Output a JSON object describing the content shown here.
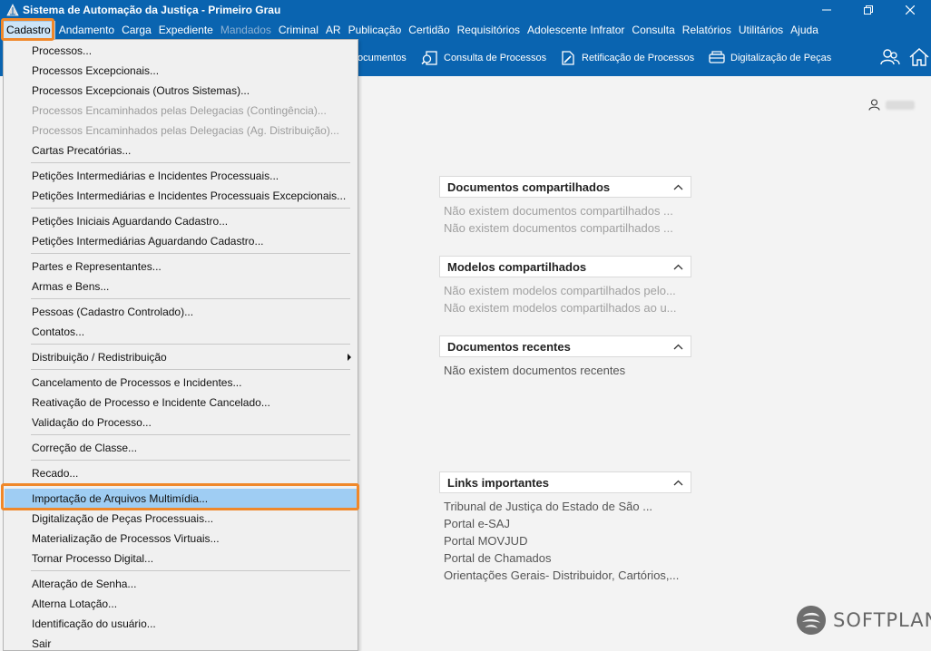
{
  "window": {
    "title": "Sistema de Automação da Justiça - Primeiro Grau"
  },
  "menubar": {
    "items": [
      {
        "label": "Cadastro",
        "state": "active"
      },
      {
        "label": "Andamento",
        "state": "normal"
      },
      {
        "label": "Carga",
        "state": "normal"
      },
      {
        "label": "Expediente",
        "state": "normal"
      },
      {
        "label": "Mandados",
        "state": "disabled"
      },
      {
        "label": "Criminal",
        "state": "normal"
      },
      {
        "label": "AR",
        "state": "normal"
      },
      {
        "label": "Publicação",
        "state": "normal"
      },
      {
        "label": "Certidão",
        "state": "normal"
      },
      {
        "label": "Requisitórios",
        "state": "normal"
      },
      {
        "label": "Adolescente Infrator",
        "state": "normal"
      },
      {
        "label": "Consulta",
        "state": "normal"
      },
      {
        "label": "Relatórios",
        "state": "normal"
      },
      {
        "label": "Utilitários",
        "state": "normal"
      },
      {
        "label": "Ajuda",
        "state": "normal"
      }
    ]
  },
  "toolbar": {
    "partial_label": "ocumentos",
    "consulta_label": "Consulta de Processos",
    "retificacao_label": "Retificação de Processos",
    "digitalizacao_label": "Digitalização de Peças"
  },
  "cadastro_menu": {
    "items": [
      {
        "label": "Processos...",
        "disabled": false
      },
      {
        "label": "Processos Excepcionais...",
        "disabled": false
      },
      {
        "label": "Processos Excepcionais (Outros Sistemas)...",
        "disabled": false
      },
      {
        "label": "Processos Encaminhados pelas Delegacias (Contingência)...",
        "disabled": true
      },
      {
        "label": "Processos Encaminhados pelas Delegacias (Ag. Distribuição)...",
        "disabled": true
      },
      {
        "label": "Cartas Precatórias...",
        "disabled": false
      },
      {
        "label": "Petições Intermediárias e Incidentes Processuais...",
        "disabled": false
      },
      {
        "label": "Petições Intermediárias e Incidentes Processuais Excepcionais...",
        "disabled": false
      },
      {
        "label": "Petições Iniciais Aguardando Cadastro...",
        "disabled": false
      },
      {
        "label": "Petições Intermediárias Aguardando Cadastro...",
        "disabled": false
      },
      {
        "label": "Partes e Representantes...",
        "disabled": false
      },
      {
        "label": "Armas e Bens...",
        "disabled": false
      },
      {
        "label": "Pessoas (Cadastro Controlado)...",
        "disabled": false
      },
      {
        "label": "Contatos...",
        "disabled": false
      },
      {
        "label": "Distribuição / Redistribuição",
        "disabled": false,
        "submenu": true
      },
      {
        "label": "Cancelamento de Processos e Incidentes...",
        "disabled": false
      },
      {
        "label": "Reativação de Processo e Incidente Cancelado...",
        "disabled": false
      },
      {
        "label": "Validação do Processo...",
        "disabled": false
      },
      {
        "label": "Correção de Classe...",
        "disabled": false
      },
      {
        "label": "Recado...",
        "disabled": false
      },
      {
        "label": "Importação de Arquivos Multimídia...",
        "disabled": false,
        "highlighted": true
      },
      {
        "label": "Digitalização de Peças Processuais...",
        "disabled": false
      },
      {
        "label": "Materialização de Processos Virtuais...",
        "disabled": false
      },
      {
        "label": "Tornar Processo Digital...",
        "disabled": false
      },
      {
        "label": "Alteração de Senha...",
        "disabled": false
      },
      {
        "label": "Alterna Lotação...",
        "disabled": false
      },
      {
        "label": "Identificação do usuário...",
        "disabled": false
      },
      {
        "label": "Sair",
        "disabled": false
      }
    ]
  },
  "panels": {
    "documentos_compartilhados": {
      "title": "Documentos compartilhados",
      "lines": [
        "Não existem documentos compartilhados ...",
        "Não existem documentos compartilhados ..."
      ]
    },
    "modelos_compartilhados": {
      "title": "Modelos compartilhados",
      "lines": [
        "Não existem modelos compartilhados pelo...",
        "Não existem modelos compartilhados ao u..."
      ]
    },
    "documentos_recentes": {
      "title": "Documentos recentes",
      "lines": [
        "Não existem documentos recentes"
      ]
    },
    "links_importantes": {
      "title": "Links importantes",
      "lines": [
        "Tribunal de Justiça do Estado de São ...",
        "Portal e-SAJ",
        "Portal MOVJUD",
        "Portal de Chamados",
        "Orientações Gerais- Distribuidor, Cartórios,..."
      ]
    }
  },
  "brand": {
    "name": "SOFTPLAN"
  },
  "colors": {
    "chrome_blue": "#0a64b0",
    "highlight_orange": "#f0882a",
    "menu_selection": "#9fcdf3"
  }
}
